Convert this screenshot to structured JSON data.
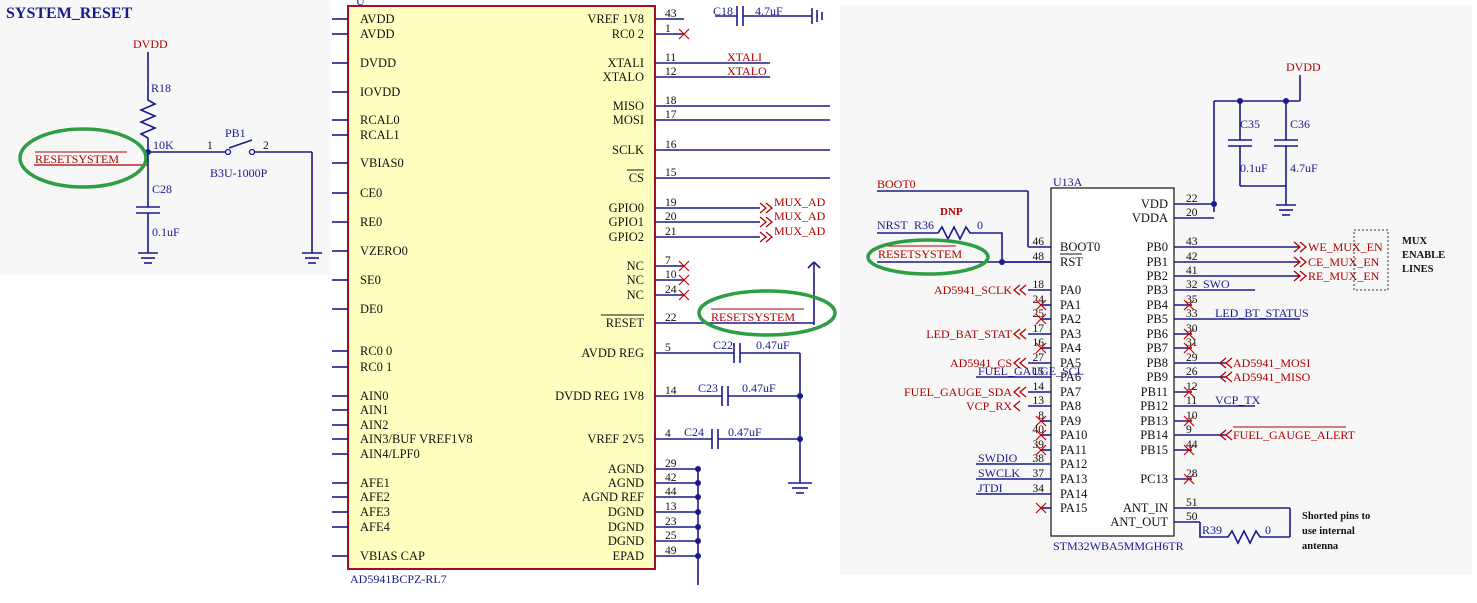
{
  "title": "SYSTEM_RESET",
  "reset_circuit": {
    "supply": "DVDD",
    "resistor_ref": "R18",
    "resistor_value": "10K",
    "net": "RESETSYSTEM",
    "switch_ref": "PB1",
    "switch_part": "B3U-1000P",
    "switch_pin1": "1",
    "switch_pin2": "2",
    "cap_ref": "C28",
    "cap_value": "0.1uF"
  },
  "ad5941": {
    "part": "AD5941BCPZ-RL7",
    "left_pins": [
      "AVDD",
      "AVDD",
      "DVDD",
      "IOVDD",
      "RCAL0",
      "RCAL1",
      "VBIAS0",
      "CE0",
      "RE0",
      "VZERO0",
      "SE0",
      "DE0",
      "RC0 0",
      "RC0 1",
      "AIN0",
      "AIN1",
      "AIN2",
      "AIN3/BUF VREF1V8",
      "AIN4/LPF0",
      "AFE1",
      "AFE2",
      "AFE3",
      "AFE4",
      "VBIAS CAP"
    ],
    "right_pins": [
      {
        "name": "VREF 1V8",
        "num": "43"
      },
      {
        "name": "RC0 2",
        "num": "1"
      },
      {
        "name": "XTALI",
        "num": "11",
        "net": "XTALI"
      },
      {
        "name": "XTALO",
        "num": "12",
        "net": "XTALO"
      },
      {
        "name": "MISO",
        "num": "18"
      },
      {
        "name": "MOSI",
        "num": "17"
      },
      {
        "name": "SCLK",
        "num": "16"
      },
      {
        "name": "CS",
        "num": "15"
      },
      {
        "name": "GPIO0",
        "num": "19",
        "net": "MUX_AD"
      },
      {
        "name": "GPIO1",
        "num": "20",
        "net": "MUX_AD"
      },
      {
        "name": "GPIO2",
        "num": "21",
        "net": "MUX_AD"
      },
      {
        "name": "NC",
        "num": "7"
      },
      {
        "name": "NC",
        "num": "10"
      },
      {
        "name": "NC",
        "num": "24"
      },
      {
        "name": "RESET",
        "num": "22",
        "net": "RESETSYSTEM"
      },
      {
        "name": "AVDD REG",
        "num": "5"
      },
      {
        "name": "DVDD REG 1V8",
        "num": "14"
      },
      {
        "name": "VREF 2V5",
        "num": "4"
      },
      {
        "name": "AGND",
        "num": "29"
      },
      {
        "name": "AGND",
        "num": "42"
      },
      {
        "name": "AGND REF",
        "num": "44"
      },
      {
        "name": "DGND",
        "num": "13"
      },
      {
        "name": "DGND",
        "num": "23"
      },
      {
        "name": "DGND",
        "num": "25"
      },
      {
        "name": "EPAD",
        "num": "49"
      }
    ],
    "caps": [
      {
        "ref": "C18",
        "value": "4.7uF"
      },
      {
        "ref": "C22",
        "value": "0.47uF"
      },
      {
        "ref": "C23",
        "value": "0.47uF"
      },
      {
        "ref": "C24",
        "value": "0.47uF"
      }
    ]
  },
  "stm32": {
    "ref": "U13A",
    "part": "STM32WBA5MMGH6TR",
    "supply": "DVDD",
    "caps": [
      {
        "ref": "C35",
        "value": "0.1uF"
      },
      {
        "ref": "C36",
        "value": "4.7uF"
      }
    ],
    "boot_net": "BOOT0",
    "nrst_label": "NRST",
    "r36_ref": "R36",
    "r36_value": "0",
    "r36_note": "DNP",
    "reset_net": "RESETSYSTEM",
    "left_pins": [
      {
        "name": "BOOT0",
        "num": "46"
      },
      {
        "name": "RST",
        "num": "48"
      },
      {
        "name": "PA0",
        "num": "18",
        "net": "AD5941_SCLK"
      },
      {
        "name": "PA1",
        "num": "24"
      },
      {
        "name": "PA2",
        "num": "25"
      },
      {
        "name": "PA3",
        "num": "17",
        "net": "LED_BAT_STAT"
      },
      {
        "name": "PA4",
        "num": "16"
      },
      {
        "name": "PA5",
        "num": "27",
        "net": "AD5941_CS"
      },
      {
        "name": "PA6",
        "num": "15",
        "net": "FUEL_GAUGE_SCL"
      },
      {
        "name": "PA7",
        "num": "14",
        "net": "FUEL_GAUGE_SDA"
      },
      {
        "name": "PA8",
        "num": "13",
        "net": "VCP_RX"
      },
      {
        "name": "PA9",
        "num": "8"
      },
      {
        "name": "PA10",
        "num": "40"
      },
      {
        "name": "PA11",
        "num": "39"
      },
      {
        "name": "PA12",
        "num": "38",
        "net": "SWDIO"
      },
      {
        "name": "PA13",
        "num": "37",
        "net": "SWCLK"
      },
      {
        "name": "PA14",
        "num": "34",
        "net": "JTDI"
      },
      {
        "name": "PA15",
        "num": ""
      }
    ],
    "right_pins": [
      {
        "name": "VDD",
        "num": "22"
      },
      {
        "name": "VDDA",
        "num": "20"
      },
      {
        "name": "PB0",
        "num": "43",
        "net": "WE_MUX_EN"
      },
      {
        "name": "PB1",
        "num": "42",
        "net": "CE_MUX_EN"
      },
      {
        "name": "PB2",
        "num": "41",
        "net": "RE_MUX_EN"
      },
      {
        "name": "PB3",
        "num": "32",
        "net": "SWO"
      },
      {
        "name": "PB4",
        "num": "35"
      },
      {
        "name": "PB5",
        "num": "33",
        "net": "LED_BT_STATUS"
      },
      {
        "name": "PB6",
        "num": "30"
      },
      {
        "name": "PB7",
        "num": "31"
      },
      {
        "name": "PB8",
        "num": "29",
        "net": "AD5941_MOSI"
      },
      {
        "name": "PB9",
        "num": "26",
        "net": "AD5941_MISO"
      },
      {
        "name": "PB11",
        "num": "12"
      },
      {
        "name": "PB12",
        "num": "11",
        "net": "VCP_TX"
      },
      {
        "name": "PB13",
        "num": "10"
      },
      {
        "name": "PB14",
        "num": "9",
        "net": "FUEL_GAUGE_ALERT"
      },
      {
        "name": "PB15",
        "num": "44"
      },
      {
        "name": "PC13",
        "num": "28"
      },
      {
        "name": "ANT_IN",
        "num": "51"
      },
      {
        "name": "ANT_OUT",
        "num": "50"
      }
    ],
    "r39_ref": "R39",
    "r39_value": "0",
    "mux_note": [
      "MUX",
      "ENABLE",
      "LINES"
    ],
    "antenna_note": [
      "Shorted pins to",
      "use internal",
      "antenna"
    ]
  },
  "colors": {
    "wire": "#1a1a8c",
    "net_label": "#b00000",
    "chip_fill": "#ffffc0",
    "chip_border": "#a0102a",
    "highlight": "#2e9e45"
  }
}
